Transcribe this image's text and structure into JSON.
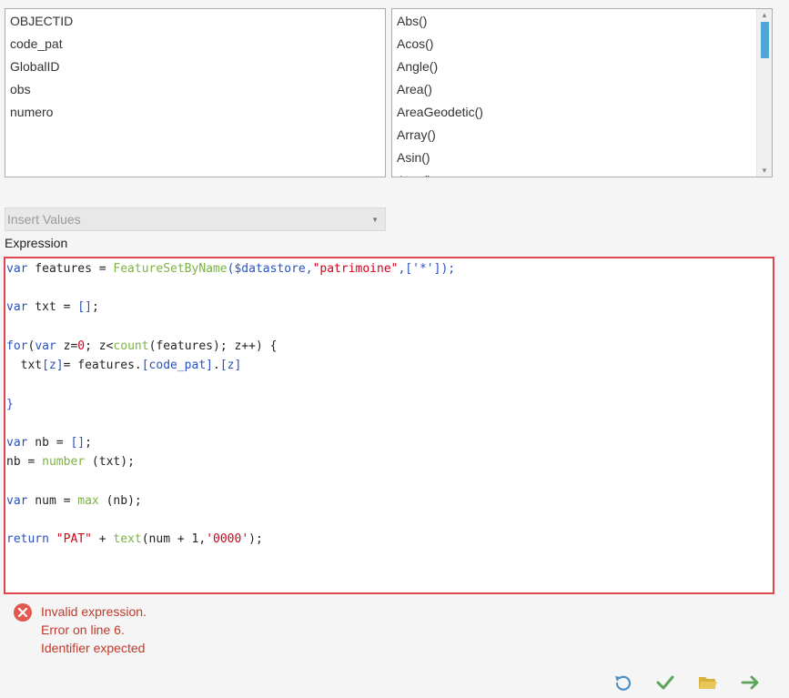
{
  "fields": [
    "OBJECTID",
    "code_pat",
    "GlobalID",
    "obs",
    "numero"
  ],
  "functions": [
    "Abs()",
    "Acos()",
    "Angle()",
    "Area()",
    "AreaGeodetic()",
    "Array()",
    "Asin()",
    "Atan()"
  ],
  "insert_values": {
    "label": "Insert Values"
  },
  "expression": {
    "label": "Expression"
  },
  "code": {
    "l1": {
      "a": "var",
      "b": " features = ",
      "c": "FeatureSetByName",
      "d": "($datastore,",
      "e": "\"patrimoine\"",
      "f": ",['*']);"
    },
    "l3": {
      "a": "var",
      "b": " txt = ",
      "c": "[]",
      "d": ";"
    },
    "l5": {
      "a": "for",
      "b": "(",
      "c": "var",
      "d": " z=",
      "e": "0",
      "f": "; z<",
      "g": "count",
      "h": "(features); z++) {"
    },
    "l6": {
      "a": "  txt",
      "b": "[z]",
      "c": "= features.",
      "d": "[code_pat]",
      "e": ".",
      "f": "[z]"
    },
    "l8": {
      "a": "}"
    },
    "l10": {
      "a": "var",
      "b": " nb = ",
      "c": "[]",
      "d": ";"
    },
    "l11": {
      "a": "nb = ",
      "b": "number",
      "c": " (txt);"
    },
    "l13": {
      "a": "var",
      "b": " num = ",
      "c": "max",
      "d": " (nb);"
    },
    "l15": {
      "a": "return",
      "b": " ",
      "c": "\"PAT\"",
      "d": " + ",
      "e": "text",
      "f": "(num + 1,",
      "g": "'0000'",
      "h": ");"
    }
  },
  "error": {
    "line1": "Invalid expression.",
    "line2": "Error on line 6.",
    "line3": "Identifier expected"
  },
  "colors": {
    "keyword": "#2a52be",
    "function": "#7cb342",
    "string": "#d0021b",
    "error": "#c0392b",
    "editor_border": "#e0464f"
  },
  "icons": {
    "reset": "undo-icon",
    "verify": "check-icon",
    "open": "folder-icon",
    "next": "arrow-right-icon",
    "error": "error-circle-icon"
  }
}
